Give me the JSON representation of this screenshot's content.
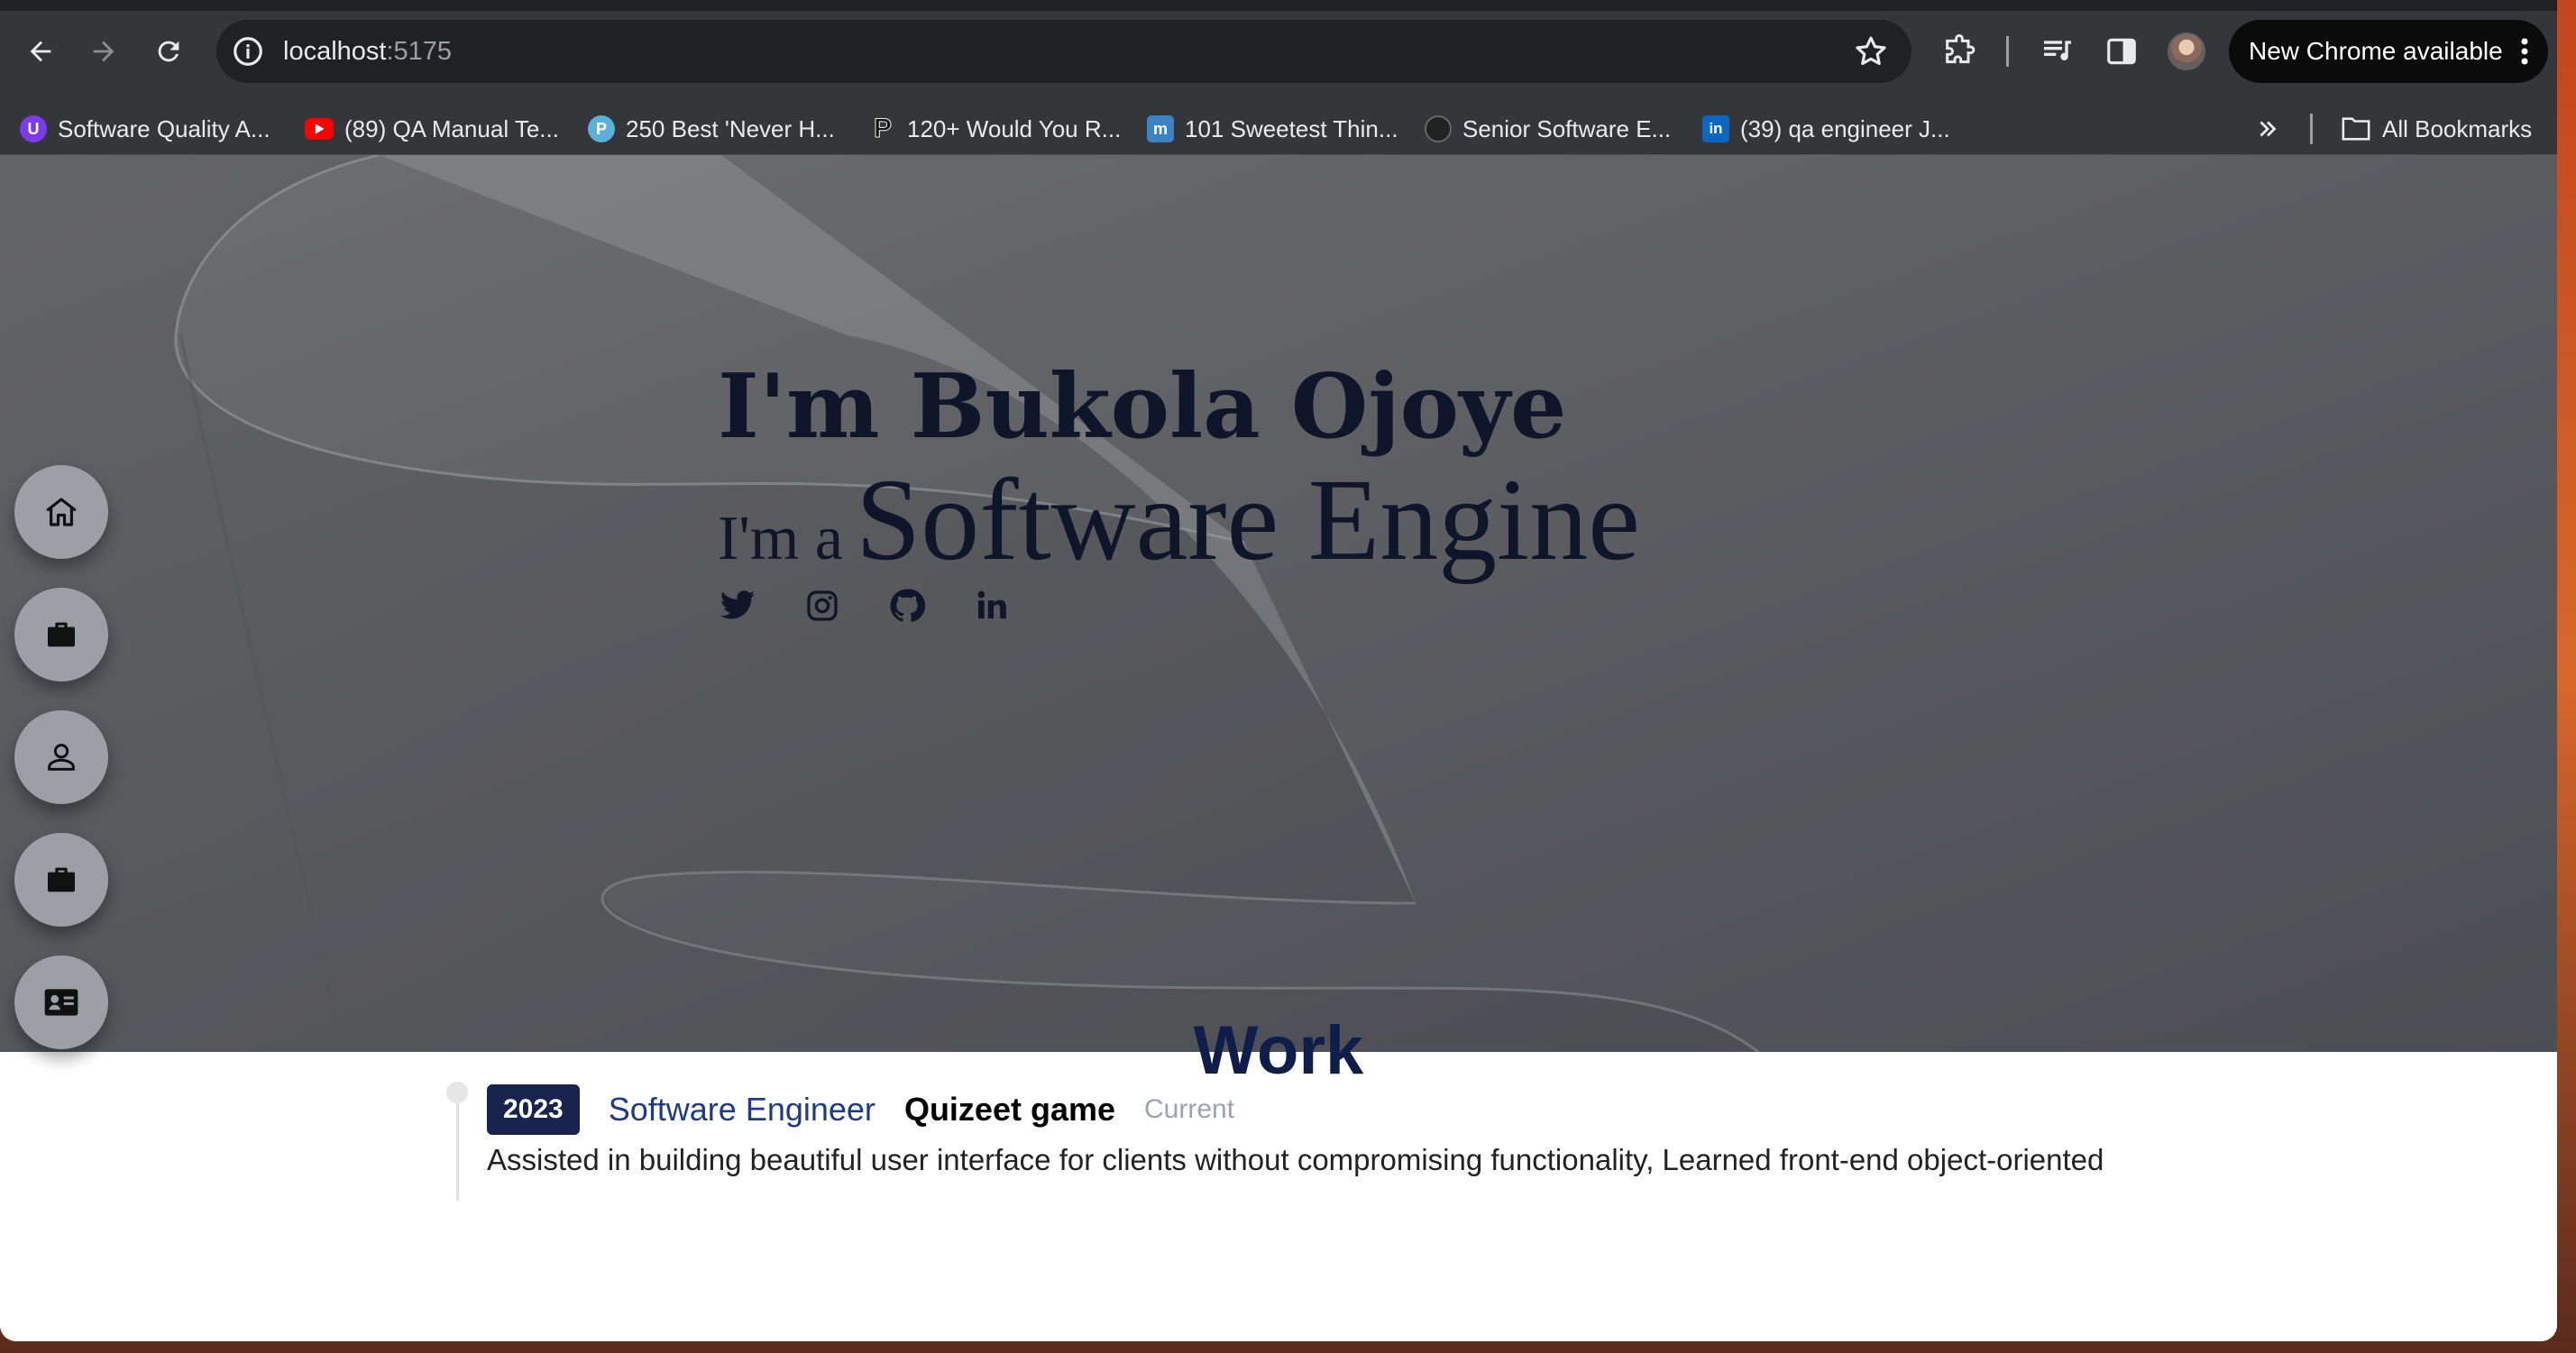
{
  "browser": {
    "url_host": "localhost",
    "url_port": ":5175",
    "update_label": "New Chrome available"
  },
  "bookmarks": {
    "items": [
      {
        "label": "Software Quality A...",
        "icon": "u-icon",
        "color": "#7c3aed"
      },
      {
        "label": "(89) QA Manual Te...",
        "icon": "youtube-icon",
        "color": "#ff0000"
      },
      {
        "label": "250 Best 'Never H...",
        "icon": "p-circle-icon",
        "color": "#5ab0d6"
      },
      {
        "label": "120+ Would You R...",
        "icon": "p-bold-icon",
        "color": "#000000"
      },
      {
        "label": "101 Sweetest Thin...",
        "icon": "m-icon",
        "color": "#3b82c4"
      },
      {
        "label": "Senior Software E...",
        "icon": "dark-circle-icon",
        "color": "#222222"
      },
      {
        "label": "(39) qa engineer J...",
        "icon": "linkedin-icon",
        "color": "#0a66c2"
      }
    ],
    "all_label": "All Bookmarks"
  },
  "hero": {
    "title": "I'm Bukola Ojoye",
    "prefix": "I'm a",
    "role": "Software Engine",
    "socials": [
      "twitter-icon",
      "instagram-icon",
      "github-icon",
      "linkedin-icon"
    ]
  },
  "side_nav": [
    "home-icon",
    "briefcase-icon",
    "person-icon",
    "briefcase-icon",
    "contact-card-icon"
  ],
  "work": {
    "title": "Work",
    "jobs": [
      {
        "year": "2023",
        "role": "Software Engineer",
        "company": "Quizeet game",
        "status": "Current",
        "description": "Assisted in building beautiful user interface for clients without compromising functionality, Learned front-end object-oriented"
      }
    ]
  }
}
